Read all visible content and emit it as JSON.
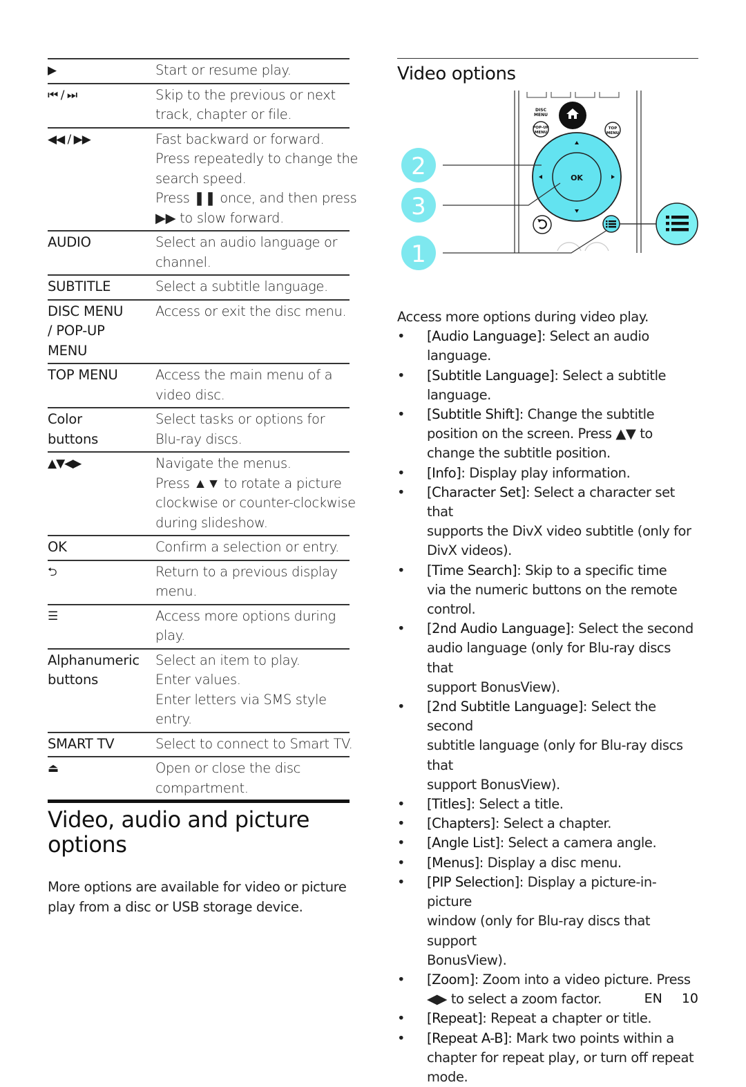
{
  "key_table": {
    "rows": [
      {
        "key_icon": "play-icon",
        "key": "▶",
        "desc": [
          "Start or resume play."
        ]
      },
      {
        "key_icon": "prev-next-icon",
        "key": "⏮ / ⏭",
        "desc": [
          "Skip to the previous or next",
          "track, chapter or file."
        ]
      },
      {
        "key_icon": "rewind-forward-icon",
        "key": "◀◀ / ▶▶",
        "desc": [
          "Fast backward or forward.",
          "Press repeatedly to change the",
          "search speed.",
          "Press ❚❚ once, and then press",
          "▶▶ to slow forward."
        ]
      },
      {
        "key": "AUDIO",
        "desc": [
          "Select an audio language or",
          "channel."
        ]
      },
      {
        "key": "SUBTITLE",
        "desc": [
          "Select a subtitle language."
        ]
      },
      {
        "key": "DISC MENU / POP-UP MENU",
        "key_lines": [
          "DISC MENU",
          "/ POP-UP",
          "MENU"
        ],
        "desc": [
          "Access or exit the disc menu."
        ]
      },
      {
        "key": "TOP MENU",
        "desc": [
          "Access the main menu of a",
          "video disc."
        ]
      },
      {
        "key": "Color buttons",
        "key_lines": [
          "Color",
          "buttons"
        ],
        "desc": [
          "Select tasks or options for",
          "Blu-ray discs."
        ]
      },
      {
        "key_icon": "navigation-arrows-icon",
        "key": "▲▼◀▶",
        "desc": [
          "Navigate the menus.",
          "Press ▲▼ to rotate a picture",
          "clockwise or counter-clockwise",
          "during slideshow."
        ]
      },
      {
        "key": "OK",
        "desc": [
          "Confirm a selection or entry."
        ]
      },
      {
        "key_icon": "back-icon",
        "key": "⮌",
        "desc": [
          "Return to a previous display",
          "menu."
        ]
      },
      {
        "key_icon": "options-icon",
        "key": "☰",
        "desc": [
          "Access more options during",
          "play."
        ]
      },
      {
        "key": "Alphanumeric buttons",
        "key_lines": [
          "Alphanumeric",
          "buttons"
        ],
        "desc": [
          "Select an item to play.",
          "Enter values.",
          "Enter letters via SMS style",
          "entry."
        ]
      },
      {
        "key": "SMART TV",
        "desc": [
          "Select to connect to Smart TV."
        ]
      },
      {
        "key_icon": "eject-icon",
        "key": "⏏",
        "desc": [
          "Open or close the disc",
          "compartment."
        ]
      }
    ]
  },
  "section": {
    "title": "Video, audio and picture options",
    "title_lines": [
      "Video, audio and picture",
      "options"
    ],
    "intro_lines": [
      "More options are available for video or picture",
      "play from a disc or USB storage device."
    ]
  },
  "video_options": {
    "title": "Video options",
    "figure": {
      "callouts": [
        "2",
        "3",
        "1"
      ],
      "remote_labels": {
        "disc_menu": "DISC MENU",
        "popup": [
          "POP-UP",
          "MENU"
        ],
        "top_menu": [
          "TOP",
          "MENU"
        ],
        "ok": "OK"
      },
      "accent": "#63e3f0"
    },
    "lead": "Access more options during video play.",
    "items": [
      {
        "term": "[Audio Language]",
        "text": ": Select an audio",
        "cont": [
          "language."
        ]
      },
      {
        "term": "[Subtitle Language]",
        "text": ": Select a subtitle",
        "cont": [
          "language."
        ]
      },
      {
        "term": "[Subtitle Shift]",
        "text": ": Change the subtitle",
        "cont": [
          "position on the screen. Press ▲▼ to",
          "change the subtitle position."
        ]
      },
      {
        "term": "[Info]",
        "text": ": Display play information.",
        "cont": []
      },
      {
        "term": "[Character Set]",
        "text": ": Select a character set that",
        "cont": [
          "supports the DivX video subtitle (only for",
          "DivX videos)."
        ]
      },
      {
        "term": "[Time Search]",
        "text": ": Skip to a specific time",
        "cont": [
          "via the numeric buttons on the remote",
          "control."
        ]
      },
      {
        "term": "[2nd Audio Language]",
        "text": ": Select the second",
        "cont": [
          "audio language (only for Blu-ray discs that",
          "support BonusView)."
        ]
      },
      {
        "term": "[2nd Subtitle Language]",
        "text": ": Select the second",
        "cont": [
          "subtitle language (only for Blu-ray discs that",
          "support BonusView)."
        ]
      },
      {
        "term": "[Titles]",
        "text": ": Select a title.",
        "cont": []
      },
      {
        "term": "[Chapters]",
        "text": ": Select a chapter.",
        "cont": []
      },
      {
        "term": "[Angle List]",
        "text": ": Select a camera angle.",
        "cont": []
      },
      {
        "term": "[Menus]",
        "text": ": Display a disc menu.",
        "cont": []
      },
      {
        "term": "[PIP Selection]",
        "text": ": Display a picture-in-picture",
        "cont": [
          "window (only for Blu-ray discs that support",
          "BonusView)."
        ]
      },
      {
        "term": "[Zoom]",
        "text": ": Zoom into a video picture. Press",
        "cont": [
          "◀▶ to select a zoom factor."
        ]
      },
      {
        "term": "[Repeat]",
        "text": ": Repeat a chapter or title.",
        "cont": []
      },
      {
        "term": "[Repeat A-B]",
        "text": ": Mark two points within a",
        "cont": [
          "chapter for repeat play, or turn off repeat",
          "mode."
        ]
      }
    ]
  },
  "footer": {
    "lang": "EN",
    "page": "10"
  }
}
